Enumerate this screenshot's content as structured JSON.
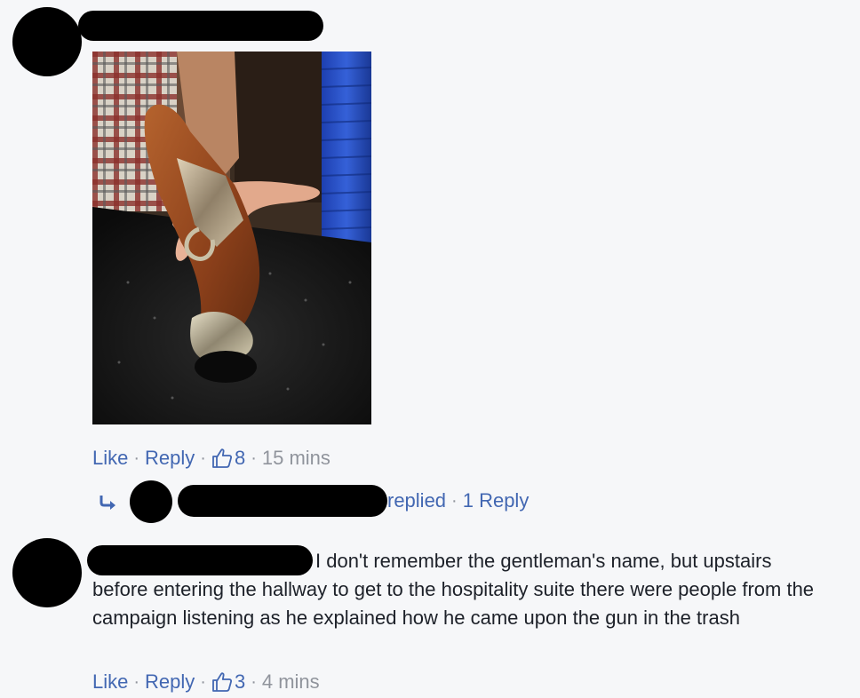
{
  "comment1": {
    "actions": {
      "like": "Like",
      "reply": "Reply",
      "likes_count": "8",
      "time": "15 mins"
    }
  },
  "reply_summary": {
    "replied_text": "replied",
    "reply_count_text": "1 Reply"
  },
  "comment2": {
    "text_line1": "I don't remember the gentleman's name, but upstairs",
    "text_rest": "before entering the hallway to get to the hospitality suite there were people from the campaign listening as he explained how he came upon the gun in the trash",
    "actions": {
      "like": "Like",
      "reply": "Reply",
      "likes_count": "3",
      "time": "4 mins"
    }
  },
  "separator": "·",
  "colors": {
    "link": "#4267b2",
    "meta": "#90949c",
    "background": "#f6f7f9"
  },
  "icons": {
    "like_icon": "thumbs-up-outline",
    "reply_arrow": "curved-arrow-right"
  }
}
